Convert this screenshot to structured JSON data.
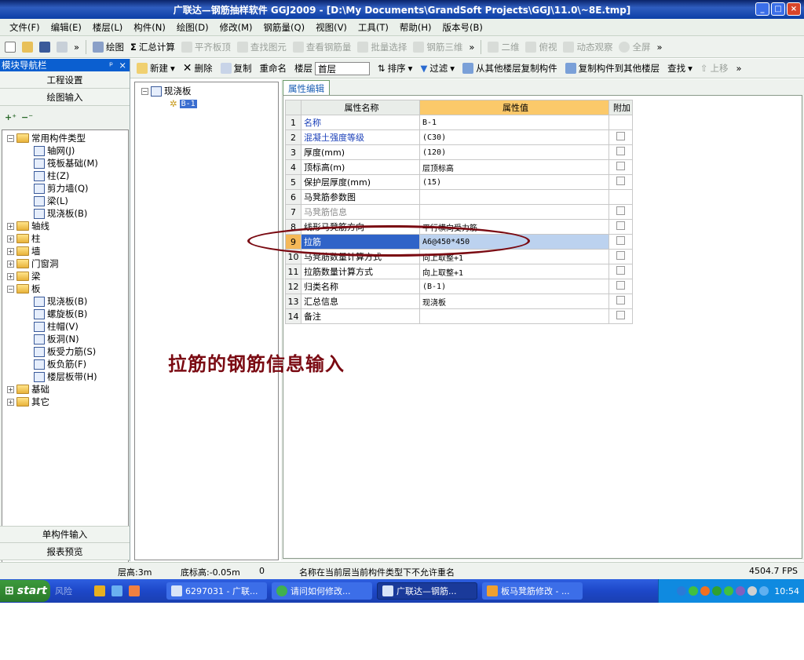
{
  "window": {
    "title": "广联达—钢筋抽样软件 GGJ2009 - [D:\\My Documents\\GrandSoft Projects\\GGJ\\11.0\\~8E.tmp]",
    "min": "_",
    "max": "□",
    "close": "×"
  },
  "menu": [
    "文件(F)",
    "编辑(E)",
    "楼层(L)",
    "构件(N)",
    "绘图(D)",
    "修改(M)",
    "钢筋量(Q)",
    "视图(V)",
    "工具(T)",
    "帮助(H)",
    "版本号(B)"
  ],
  "toolbar1": {
    "draw": "绘图",
    "sum": "汇总计算",
    "flatten": "平齐板顶",
    "find_elem": "查找图元",
    "view_rebar": "查看钢筋量",
    "batch": "批量选择",
    "rebar3d": "钢筋三维",
    "two_d": "二维",
    "view": "俯视",
    "dyn": "动态观察",
    "full": "全屏",
    "more": "»"
  },
  "nav": {
    "title": "模块导航栏",
    "pin": "ᵖ",
    "close": "×",
    "tab1": "工程设置",
    "tab2": "绘图输入",
    "bottom1": "单构件输入",
    "bottom2": "报表预览",
    "tree": [
      {
        "label": "常用构件类型",
        "level": 0,
        "exp": "-",
        "type": "folder"
      },
      {
        "label": "轴网(J)",
        "level": 1,
        "type": "item"
      },
      {
        "label": "筏板基础(M)",
        "level": 1,
        "type": "item"
      },
      {
        "label": "柱(Z)",
        "level": 1,
        "type": "item"
      },
      {
        "label": "剪力墙(Q)",
        "level": 1,
        "type": "item"
      },
      {
        "label": "梁(L)",
        "level": 1,
        "type": "item"
      },
      {
        "label": "现浇板(B)",
        "level": 1,
        "type": "item"
      },
      {
        "label": "轴线",
        "level": 0,
        "exp": "+",
        "type": "folder"
      },
      {
        "label": "柱",
        "level": 0,
        "exp": "+",
        "type": "folder"
      },
      {
        "label": "墙",
        "level": 0,
        "exp": "+",
        "type": "folder"
      },
      {
        "label": "门窗洞",
        "level": 0,
        "exp": "+",
        "type": "folder"
      },
      {
        "label": "梁",
        "level": 0,
        "exp": "+",
        "type": "folder"
      },
      {
        "label": "板",
        "level": 0,
        "exp": "-",
        "type": "folder"
      },
      {
        "label": "现浇板(B)",
        "level": 1,
        "type": "item"
      },
      {
        "label": "螺旋板(B)",
        "level": 1,
        "type": "item"
      },
      {
        "label": "柱帽(V)",
        "level": 1,
        "type": "item"
      },
      {
        "label": "板洞(N)",
        "level": 1,
        "type": "item"
      },
      {
        "label": "板受力筋(S)",
        "level": 1,
        "type": "item"
      },
      {
        "label": "板负筋(F)",
        "level": 1,
        "type": "item"
      },
      {
        "label": "楼层板带(H)",
        "level": 1,
        "type": "item"
      },
      {
        "label": "基础",
        "level": 0,
        "exp": "+",
        "type": "folder"
      },
      {
        "label": "其它",
        "level": 0,
        "exp": "+",
        "type": "folder"
      }
    ]
  },
  "toolbar2": {
    "new": "新建",
    "delete": "删除",
    "copy": "复制",
    "rename": "重命名",
    "floor_label": "楼层",
    "floor_value": "首层",
    "sort": "排序",
    "filter": "过滤",
    "copy_from": "从其他楼层复制构件",
    "copy_to": "复制构件到其他楼层",
    "find": "查找",
    "up": "上移",
    "more": "»"
  },
  "comptree": {
    "root": "现浇板",
    "child": "B-1"
  },
  "props": {
    "tab": "属性编辑",
    "col_name": "属性名称",
    "col_value": "属性值",
    "col_extra": "附加",
    "rows": [
      {
        "n": "1",
        "name": "名称",
        "value": "B-1",
        "style": "blue",
        "chk": false
      },
      {
        "n": "2",
        "name": "混凝土强度等级",
        "value": "(C30)",
        "style": "blue",
        "chk": true
      },
      {
        "n": "3",
        "name": "厚度(mm)",
        "value": "(120)",
        "style": "",
        "chk": true
      },
      {
        "n": "4",
        "name": "顶标高(m)",
        "value": "层顶标高",
        "style": "",
        "chk": true
      },
      {
        "n": "5",
        "name": "保护层厚度(mm)",
        "value": "(15)",
        "style": "",
        "chk": true
      },
      {
        "n": "6",
        "name": "马凳筋参数图",
        "value": "",
        "style": "",
        "chk": false
      },
      {
        "n": "7",
        "name": "马凳筋信息",
        "value": "",
        "style": "gray",
        "chk": true
      },
      {
        "n": "8",
        "name": "线形马凳筋方向",
        "value": "平行横向受力筋",
        "style": "",
        "chk": true
      },
      {
        "n": "9",
        "name": "拉筋",
        "value": "A6@450*450",
        "style": "sel",
        "chk": true
      },
      {
        "n": "10",
        "name": "马凳筋数量计算方式",
        "value": "向上取整+1",
        "style": "",
        "chk": true
      },
      {
        "n": "11",
        "name": "拉筋数量计算方式",
        "value": "向上取整+1",
        "style": "",
        "chk": true
      },
      {
        "n": "12",
        "name": "归类名称",
        "value": "(B-1)",
        "style": "",
        "chk": true
      },
      {
        "n": "13",
        "name": "汇总信息",
        "value": "现浇板",
        "style": "",
        "chk": true
      },
      {
        "n": "14",
        "name": "备注",
        "value": "",
        "style": "",
        "chk": true
      }
    ]
  },
  "annotation": "拉筋的钢筋信息输入",
  "status": {
    "floor_height": "层高:3m",
    "bottom_elev": "底标高:-0.05m",
    "count": "0",
    "message": "名称在当前层当前构件类型下不允许重名",
    "fps": "4504.7 FPS"
  },
  "taskbar": {
    "start": "start",
    "items": [
      "风险",
      "6297031 - 广联...",
      "请问如何修改...",
      "广联达—钢筋...",
      "板马凳筋修改 - ..."
    ],
    "clock": "10:54"
  },
  "colors": {
    "accent": "#0b5fd0",
    "annotation": "#7a0a12",
    "header_highlight": "#fbc96a"
  }
}
